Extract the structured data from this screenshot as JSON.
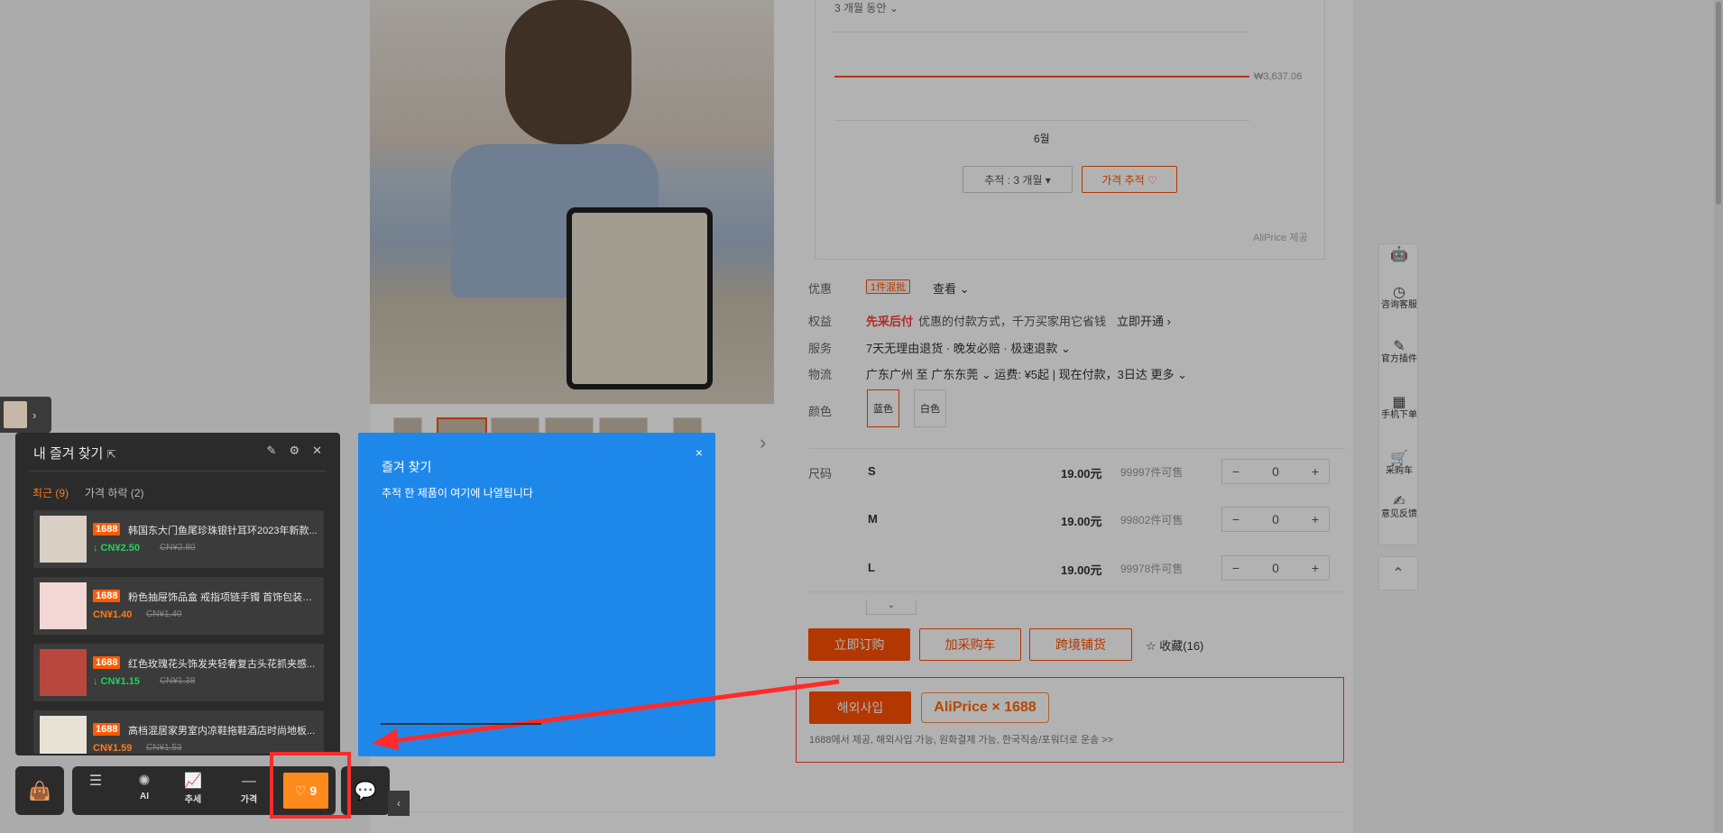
{
  "tracker": {
    "period_label": "3 개월 동안 ⌄",
    "price_label": "₩3,637.06",
    "month_label": "6월",
    "track_select": "추적 : 3 개월 ▾",
    "track_button": "가격 추적 ♡",
    "credit": "AliPrice 제공"
  },
  "product": {
    "promo_label": "优惠",
    "promo_badge": "1件混批",
    "promo_more": "查看 ⌄",
    "rights_label": "权益",
    "rights_highlight": "先采后付",
    "rights_text": "优惠的付款方式，千万买家用它省钱",
    "rights_link": "立即开通 ›",
    "service_label": "服务",
    "service_text": "7天无理由退货 · 晚发必赔 · 极速退款 ⌄",
    "logistics_label": "物流",
    "logistics_text": "广东广州 至 广东东莞 ⌄  运费: ¥5起  |  现在付款，3日达  更多 ⌄",
    "color_label": "颜色",
    "colors": [
      "蓝色",
      "白色"
    ],
    "size_label": "尺码",
    "sizes": [
      {
        "name": "S",
        "price": "19.00元",
        "stock": "99997件可售",
        "qty": "0"
      },
      {
        "name": "M",
        "price": "19.00元",
        "stock": "99802件可售",
        "qty": "0"
      },
      {
        "name": "L",
        "price": "19.00元",
        "stock": "99978件可售",
        "qty": "0"
      }
    ],
    "expand": "⌄",
    "buy_now": "立即订购",
    "add_cart": "加采购车",
    "cross_border": "跨境铺货",
    "favorite": "☆ 收藏(16)"
  },
  "aliprice": {
    "overseas_button": "해외사입",
    "tag": "AliPrice × 1688",
    "desc": "1688에서 제공, 해외사입 가능, 원화결제 가능, 한국직송/포워더로 운송 >>"
  },
  "side_toolbar": [
    {
      "icon": "robot-icon",
      "glyph": "🤖",
      "label": ""
    },
    {
      "icon": "consult-icon",
      "glyph": "◷",
      "label": "咨询客服"
    },
    {
      "icon": "plugin-icon",
      "glyph": "✎",
      "label": "官方插件"
    },
    {
      "icon": "qr-icon",
      "glyph": "▦",
      "label": "手机下单"
    },
    {
      "icon": "cart-icon",
      "glyph": "🛒",
      "label": "采购车"
    },
    {
      "icon": "feedback-icon",
      "glyph": "✍",
      "label": "意见反馈"
    }
  ],
  "side_top": "⌃",
  "favorites": {
    "title": "내 즐겨 찾기",
    "tabs": [
      "최근 (9)",
      "가격 하락 (2)"
    ],
    "items": [
      {
        "tag": "1688",
        "title": "韩国东大门鱼尾珍珠银针耳环2023年新款...",
        "price": "↓ CN¥2.50",
        "old": "CN¥2.80",
        "trend": "green"
      },
      {
        "tag": "1688",
        "title": "粉色抽屉饰品盒 戒指项链手镯 首饰包装盒 ...",
        "price": "CN¥1.40",
        "old": "CN¥1.40",
        "trend": "orange"
      },
      {
        "tag": "1688",
        "title": "红色玫瑰花头饰发夹轻奢复古头花抓夹感...",
        "price": "↓ CN¥1.15",
        "old": "CN¥1.38",
        "trend": "green"
      },
      {
        "tag": "1688",
        "title": "高档混居家男室内凉鞋拖鞋酒店时尚地板...",
        "price": "CN¥1.59",
        "old": "CN¥1.53",
        "trend": "orange"
      }
    ]
  },
  "tip": {
    "title": "즐겨 찾기",
    "body": "추적 한 제품이 여기에 나열됩니다",
    "close": "×"
  },
  "dock": {
    "items": [
      {
        "icon": "collapse-icon",
        "glyph": "☰",
        "label": ""
      },
      {
        "icon": "ai-icon",
        "glyph": "✺",
        "label": "AI"
      },
      {
        "icon": "trend-icon",
        "glyph": "📈",
        "label": "추세"
      },
      {
        "icon": "price-icon",
        "glyph": "—",
        "label": "가격"
      }
    ],
    "fav_button": "♡ 9",
    "bag_glyph": "👜",
    "chat_glyph": "💬",
    "collapse_glyph": "‹"
  },
  "colors": {
    "accent": "#ff5000",
    "tooltip_blue": "#1e88ea",
    "annotation_red": "#ff2a2a",
    "fav_orange": "#ff8a1c"
  }
}
